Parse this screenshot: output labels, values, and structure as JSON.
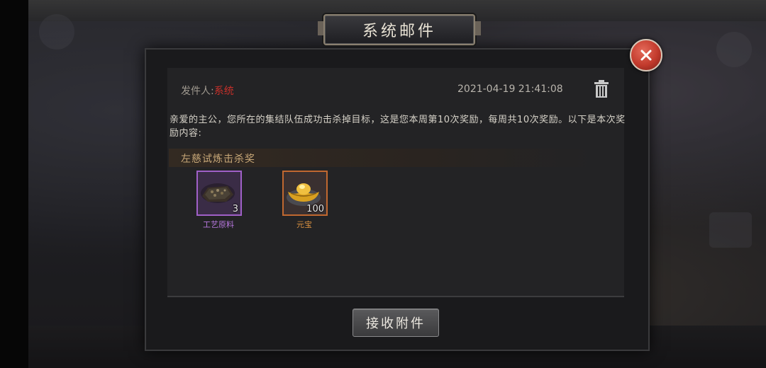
{
  "dialog": {
    "title": "系统邮件",
    "close_icon": "close-icon"
  },
  "mail": {
    "sender_label": "发件人:",
    "sender_name": "系统",
    "date": "2021-04-19 21:41:08",
    "body": "亲爱的主公，您所在的集结队伍成功击杀掉目标，这是您本周第10次奖励，每周共10次奖励。以下是本次奖励内容:",
    "delete_icon": "trash-icon"
  },
  "rewards": {
    "header": "左慈试炼击杀奖",
    "items": [
      {
        "name": "工艺原料",
        "count": "3",
        "rarity": "purple",
        "icon": "crafting-material-icon"
      },
      {
        "name": "元宝",
        "count": "100",
        "rarity": "orange",
        "icon": "gold-ingot-icon"
      }
    ]
  },
  "actions": {
    "claim_label": "接收附件"
  },
  "colors": {
    "sender_name": "#c8302a",
    "purple_rarity": "#a060c8",
    "orange_rarity": "#c06830",
    "close_button": "#c23a2c"
  }
}
